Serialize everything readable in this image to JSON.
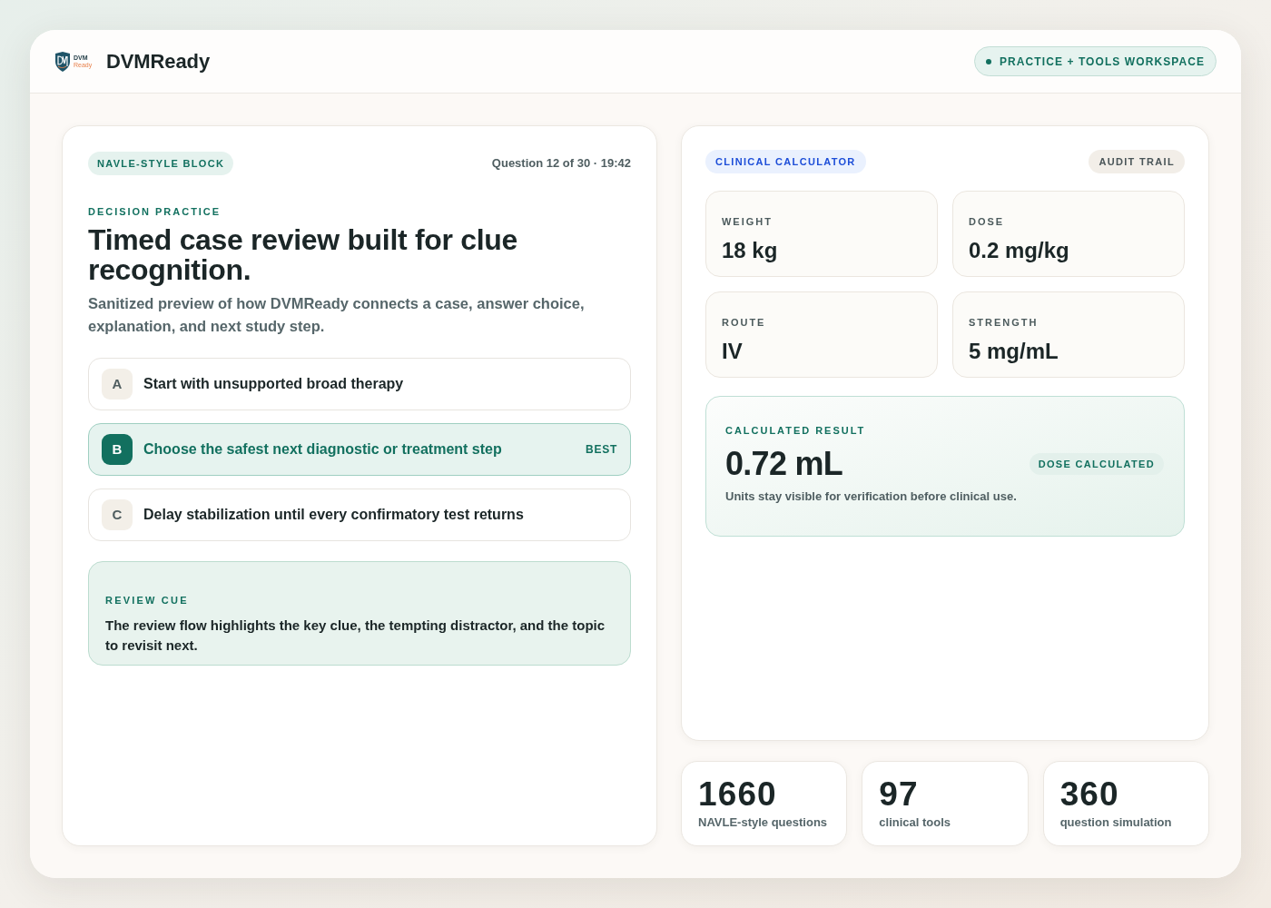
{
  "header": {
    "logo": {
      "line_1": "DVM",
      "line_2": "Ready"
    },
    "brand": "DVMReady",
    "workspace_badge": "PRACTICE + TOOLS WORKSPACE"
  },
  "question_panel": {
    "block_badge": "NAVLE-STYLE BLOCK",
    "question_counter": "Question 12 of 30 · 19:42",
    "eyebrow": "DECISION PRACTICE",
    "title": "Timed case review built for clue recognition.",
    "description": "Sanitized preview of how DVMReady connects a case, answer choice, explanation, and next study step.",
    "options": [
      {
        "letter": "A",
        "text": "Start with unsupported broad therapy",
        "selected": false
      },
      {
        "letter": "B",
        "text": "Choose the safest next diagnostic or treatment step",
        "selected": true,
        "tag": "BEST"
      },
      {
        "letter": "C",
        "text": "Delay stabilization until every confirmatory test returns",
        "selected": false
      }
    ],
    "review_cue": {
      "label": "REVIEW CUE",
      "text": "The review flow highlights the key clue, the tempting distractor, and the topic to revisit next."
    }
  },
  "calculator_panel": {
    "badge": "CLINICAL CALCULATOR",
    "audit_button": "AUDIT TRAIL",
    "fields": [
      {
        "label": "WEIGHT",
        "value": "18 kg"
      },
      {
        "label": "DOSE",
        "value": "0.2 mg/kg"
      },
      {
        "label": "ROUTE",
        "value": "IV"
      },
      {
        "label": "STRENGTH",
        "value": "5 mg/mL"
      }
    ],
    "result": {
      "label": "CALCULATED RESULT",
      "value": "0.72 mL",
      "status": "DOSE CALCULATED",
      "note": "Units stay visible for verification before clinical use."
    }
  },
  "stats": [
    {
      "value": "1660",
      "label": "NAVLE-style questions"
    },
    {
      "value": "97",
      "label": "clinical tools"
    },
    {
      "value": "360",
      "label": "question simulation"
    }
  ]
}
